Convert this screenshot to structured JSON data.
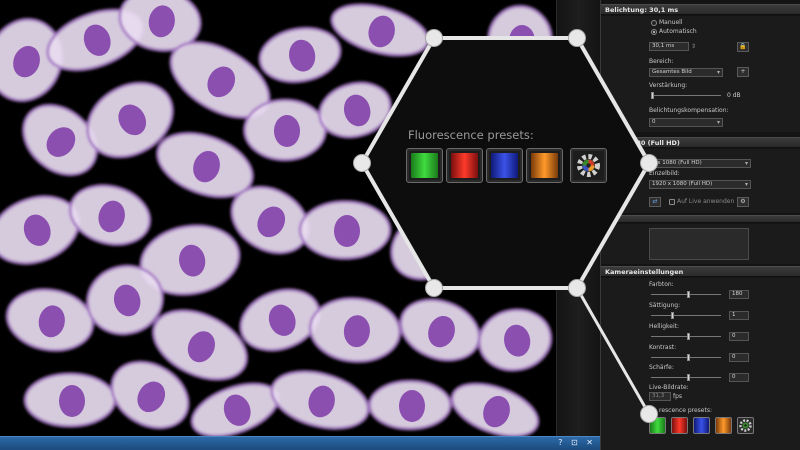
{
  "panel": {
    "exposure": {
      "header": "Belichtung: 30,1 ms",
      "mode_manual": "Manuell",
      "mode_auto": "Automatisch",
      "selected_mode": "Automatisch",
      "exposure_value": "30,1 ms",
      "area_label": "Bereich:",
      "area_value": "Gesamtes Bild",
      "gain_label": "Verstärkung:",
      "gain_value": "0 dB",
      "compensation_label": "Belichtungskompensation:",
      "compensation_value": "0"
    },
    "resolution": {
      "header": "920 x 1080 (Full HD)",
      "live_value": "0 x 1080 (Full HD)",
      "single_label": "Einzelbild:",
      "single_value": "1920 x 1080 (Full HD)",
      "apply_live": "Auf Live anwenden"
    },
    "camera": {
      "header": "Kameraeinstellungen",
      "hue_label": "Farbton:",
      "hue_value": "180",
      "saturation_label": "Sättigung:",
      "saturation_value": "1",
      "brightness_label": "Helligkeit:",
      "brightness_value": "0",
      "contrast_label": "Kontrast:",
      "contrast_value": "0",
      "sharpness_label": "Schärfe:",
      "sharpness_value": "0",
      "live_fps_label": "Live-Bildrate:",
      "live_fps_value": "31,3",
      "fps_unit": "fps",
      "presets_label": "rescence presets:"
    }
  },
  "zoom": {
    "title": "Fluorescence presets:",
    "presets": [
      {
        "name": "green-preset",
        "colors": [
          "#1a7a1a",
          "#3fdc3f",
          "#1a7a1a"
        ]
      },
      {
        "name": "red-preset",
        "colors": [
          "#7a0f0f",
          "#ff3a2a",
          "#7a0f0f"
        ]
      },
      {
        "name": "blue-preset",
        "colors": [
          "#0f1a7a",
          "#3a52e6",
          "#0f1a7a"
        ]
      },
      {
        "name": "orange-preset",
        "colors": [
          "#7a3a0a",
          "#ff9a2a",
          "#7a3a0a"
        ]
      }
    ]
  },
  "bottom_bar": {
    "controls": "? ⊡ ✕"
  },
  "colors": {
    "cell_fill": "#e9dcf0",
    "nucleus_fill": "#8b4fb0",
    "cell_edge": "#a77bc6",
    "accent_blue": "#2d6aa8"
  }
}
